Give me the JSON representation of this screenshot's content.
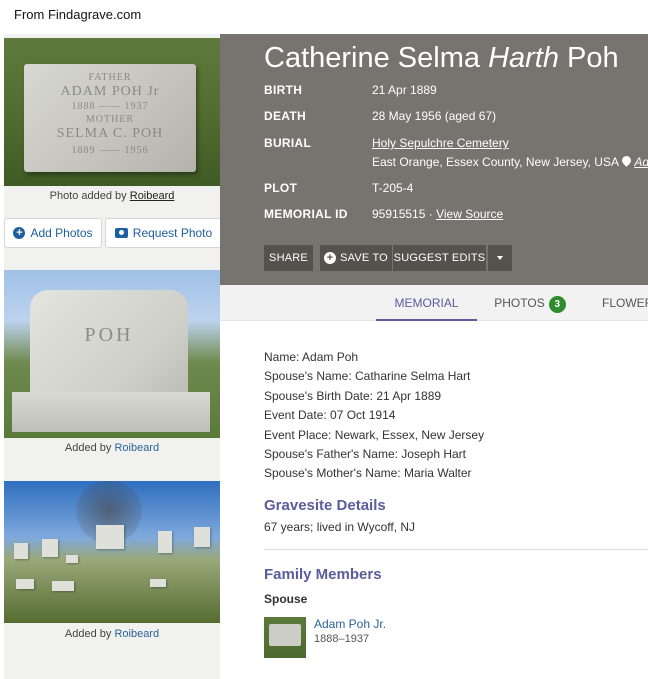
{
  "source_label": "From Findagrave.com",
  "photos": {
    "main_caption_prefix": "Photo added by",
    "main_caption_user": "Roibeard",
    "headstone_lines": [
      "FATHER",
      "ADAM POH Jr",
      "1888 —— 1937",
      "MOTHER",
      "SELMA C. POH",
      "1889 —— 1956"
    ],
    "add_photos": "Add Photos",
    "request_photo": "Request Photo",
    "photo2_text": "POH",
    "photo2_caption_prefix": "Added by",
    "photo2_caption_user": "Roibeard",
    "photo3_caption_prefix": "Added by",
    "photo3_caption_user": "Roibeard"
  },
  "memorial": {
    "name_first": "Catherine Selma",
    "name_maiden": "Harth",
    "name_last": "Poh",
    "facts": {
      "birth_label": "BIRTH",
      "birth_value": "21 Apr 1889",
      "death_label": "DEATH",
      "death_value": "28 May 1956 (aged 67)",
      "burial_label": "BURIAL",
      "burial_cemetery": "Holy Sepulchre Cemetery",
      "burial_location": "East Orange, Essex County, New Jersey, USA",
      "burial_add": "Add",
      "plot_label": "PLOT",
      "plot_value": "T-205-4",
      "memorial_id_label": "MEMORIAL ID",
      "memorial_id_value": "95915515",
      "memorial_id_sep": " · ",
      "view_source": "View Source"
    }
  },
  "actions": {
    "share": "SHARE",
    "save_to": "SAVE TO",
    "suggest_edits": "SUGGEST EDITS"
  },
  "tabs": {
    "memorial": "MEMORIAL",
    "photos": "PHOTOS",
    "photos_count": "3",
    "flowers": "FLOWER"
  },
  "details": [
    "Name: Adam Poh",
    "Spouse's Name: Catharine Selma Hart",
    "Spouse's Birth Date: 21 Apr 1889",
    "Event Date: 07 Oct 1914",
    "Event Place: Newark, Essex, New Jersey",
    "Spouse's Father's Name: Joseph Hart",
    "Spouse's Mother's Name: Maria Walter"
  ],
  "gravesite": {
    "heading": "Gravesite Details",
    "text": "67 years; lived in Wycoff, NJ"
  },
  "family": {
    "heading": "Family Members",
    "spouse_label": "Spouse",
    "spouse_name": "Adam Poh Jr.",
    "spouse_dates": "1888–1937"
  },
  "icons": [
    "plus-circle-icon",
    "camera-icon",
    "map-pin-icon",
    "caret-down-icon"
  ],
  "colors": {
    "header_bg": "#77736e",
    "accent": "#5b5c9c",
    "link": "#2a6496",
    "badge": "#2e8b2e"
  }
}
